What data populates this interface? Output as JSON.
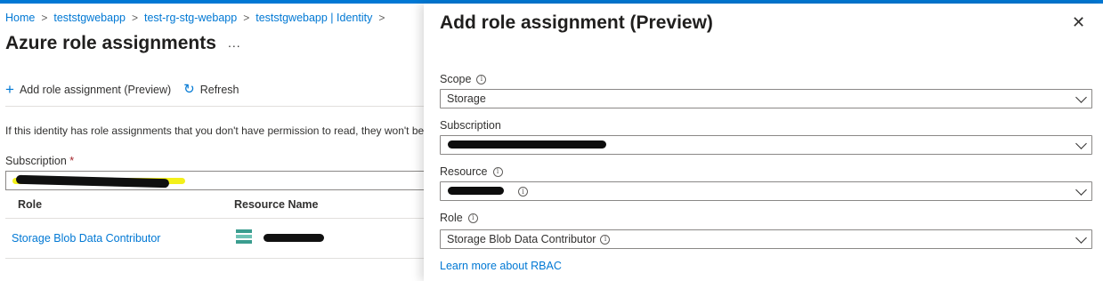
{
  "breadcrumb": {
    "items": [
      "Home",
      "teststgwebapp",
      "test-rg-stg-webapp",
      "teststgwebapp | Identity"
    ],
    "separator": ">"
  },
  "left_blade": {
    "title": "Azure role assignments",
    "more_glyph": "...",
    "commands": {
      "add_label": "Add role assignment (Preview)",
      "refresh_label": "Refresh"
    },
    "info_text": "If this identity has role assignments that you don't have permission to read, they won't be s",
    "subscription": {
      "label": "Subscription",
      "required_mark": "*"
    },
    "table": {
      "headers": [
        "Role",
        "Resource Name"
      ],
      "rows": [
        {
          "role": "Storage Blob Data Contributor"
        }
      ]
    }
  },
  "panel": {
    "title": "Add role assignment (Preview)",
    "close_glyph": "✕",
    "fields": {
      "scope": {
        "label": "Scope",
        "value": "Storage"
      },
      "subscription": {
        "label": "Subscription"
      },
      "resource": {
        "label": "Resource"
      },
      "role": {
        "label": "Role",
        "value": "Storage Blob Data Contributor"
      }
    },
    "learn_more": "Learn more about RBAC"
  },
  "icons": {
    "add": "plus-icon",
    "refresh": "refresh-icon",
    "info": "info-icon",
    "close": "close-icon",
    "chevron": "chevron-down-icon",
    "storage": "storage-account-icon"
  },
  "colors": {
    "accent": "#0078d4",
    "required": "#a4262c",
    "redaction_highlight": "#f3f01a"
  }
}
